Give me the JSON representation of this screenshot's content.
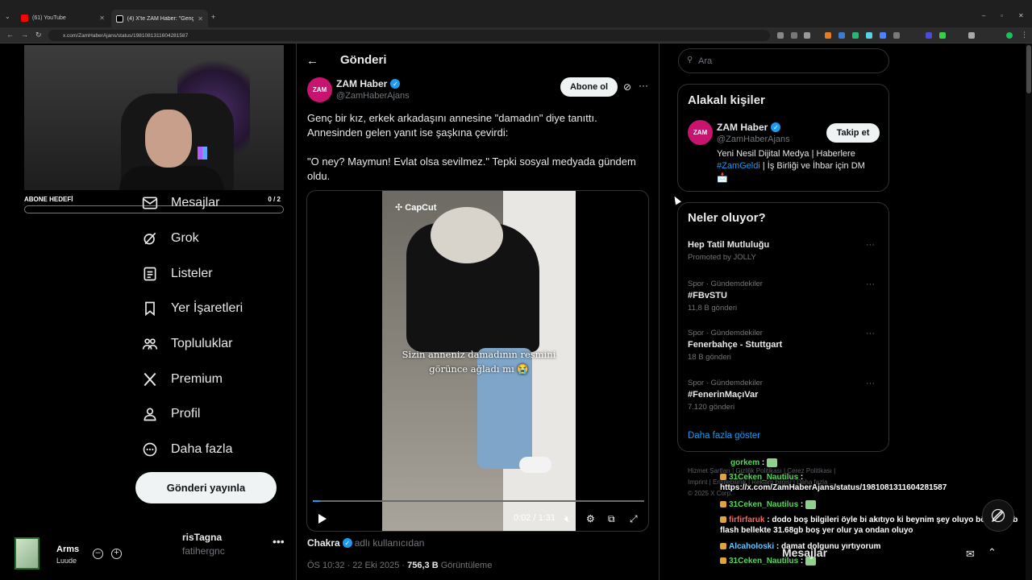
{
  "browser": {
    "tabs": [
      {
        "title": "(61) YouTube",
        "favicon_color": "#ff0000"
      },
      {
        "title": "(4) X'te ZAM Haber: \"Genç bir k",
        "favicon_color": "#ffffff"
      }
    ],
    "url": "x.com/ZamHaberAjans/status/1981081311604281587"
  },
  "stream": {
    "goal_label": "ABONE HEDEFİ",
    "goal_count": "0  / 2"
  },
  "nav": {
    "items": [
      {
        "label": "Mesajlar",
        "icon": "mail-icon"
      },
      {
        "label": "Grok",
        "icon": "grok-icon"
      },
      {
        "label": "Listeler",
        "icon": "list-icon"
      },
      {
        "label": "Yer İşaretleri",
        "icon": "bookmark-icon"
      },
      {
        "label": "Topluluklar",
        "icon": "communities-icon"
      },
      {
        "label": "Premium",
        "icon": "x-logo-icon"
      },
      {
        "label": "Profil",
        "icon": "profile-icon"
      },
      {
        "label": "Daha fazla",
        "icon": "more-circle-icon"
      }
    ],
    "post_button": "Gönderi yayınla",
    "account_name": "risTagna",
    "account_handle": "fatihergnc"
  },
  "music": {
    "title": "Arms",
    "artist": "Luude"
  },
  "post": {
    "header_title": "Gönderi",
    "author_name": "ZAM Haber",
    "author_handle": "@ZamHaberAjans",
    "avatar_text": "ZAM",
    "subscribe_label": "Abone ol",
    "text_p1": "Genç bir kız, erkek arkadaşını annesine \"damadın\" diye tanıttı. Annesinden gelen yanıt ise şaşkına çevirdi:",
    "text_p2": "\"O ney? Maymun! Evlat olsa sevilmez.\" Tepki sosyal medyada gündem oldu.",
    "video": {
      "watermark": "CapCut",
      "caption_line1": "Sizin anneniz damadının resmini",
      "caption_line2": "görünce ağladı mı 😭",
      "time": "0:02 / 1:31",
      "progress": 0.022
    },
    "source_user": "Chakra",
    "source_suffix": "adlı kullanıcıdan",
    "timestamp": "ÖS 10:32 · 22 Eki 2025 · ",
    "views_value": "756,3 B",
    "views_label": " Görüntüleme"
  },
  "sidebar": {
    "search_placeholder": "Ara",
    "related_title": "Alakalı kişiler",
    "related": {
      "name": "ZAM Haber",
      "handle": "@ZamHaberAjans",
      "bio_pre": "Yeni Nesil Dijital Medya | Haberlere ",
      "bio_tag": "#ZamGeldi",
      "bio_post": " | İş Birliği ve İhbar için DM 📩",
      "follow_label": "Takip et"
    },
    "trends_title": "Neler oluyor?",
    "trends": [
      {
        "context": "",
        "name": "Hep Tatil Mutluluğu",
        "meta": "Promoted by JOLLY"
      },
      {
        "context": "Spor · Gündemdekiler",
        "name": "#FBvSTU",
        "meta": "11,8 B gönderi"
      },
      {
        "context": "Spor · Gündemdekiler",
        "name": "Fenerbahçe - Stuttgart",
        "meta": "18 B gönderi"
      },
      {
        "context": "Spor · Gündemdekiler",
        "name": "#FenerinMaçıVar",
        "meta": "7.120 gönderi"
      }
    ],
    "show_more": "Daha fazla göster",
    "footer_line1": "Hizmet Şartları  |  Gizlilik Politikası  |  Çerez Politikası  |",
    "footer_line2": "Imprint  |  Erişilebilirlik  |  Reklam bilgisi  |  Daha fazla ...",
    "footer_line3": "© 2025 X Corp."
  },
  "chat": [
    {
      "user": "gorkem",
      "text": "",
      "user_color": "#58d45d"
    },
    {
      "user": "31Ceken_Nautilus",
      "text": "https://x.com/ZamHaberAjans/status/1981081311604281587",
      "user_color": "#58d45d"
    },
    {
      "user": "31Ceken_Nautilus",
      "text": "",
      "user_color": "#58d45d"
    },
    {
      "user": "firfirfaruk",
      "text": "dodo boş bilgileri öyle bi akıtıyo ki beynim şey oluyo böyle 32gb flash bellekte 31.68gb boş yer olur ya ondan oluyo",
      "user_color": "#ff6464"
    },
    {
      "user": "Alcaholoski",
      "text": "damat dolgunu yırtıyorum",
      "user_color": "#68c7ff"
    },
    {
      "user": "31Ceken_Nautilus",
      "text": "",
      "user_color": "#58d45d"
    }
  ],
  "bottom": {
    "messages_label": "Mesajlar"
  },
  "colors": {
    "accent": "#1d9bf0",
    "avatar_bg": "#c8146e"
  }
}
